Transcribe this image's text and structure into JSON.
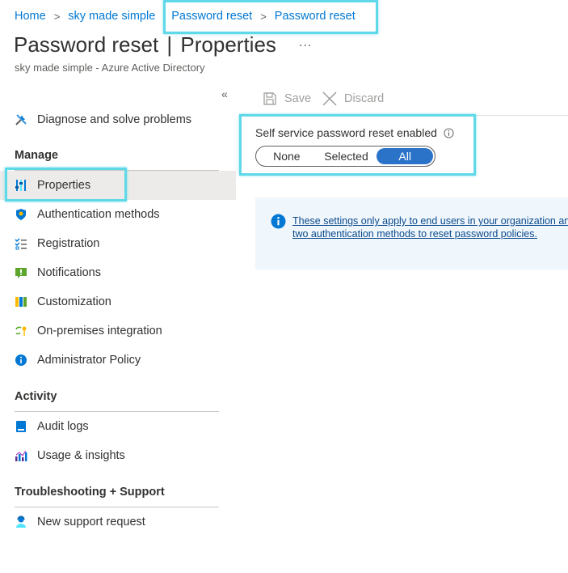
{
  "breadcrumb": {
    "items": [
      "Home",
      "sky made simple",
      "Password reset",
      "Password reset"
    ]
  },
  "header": {
    "title_main": "Password reset",
    "title_separator": "|",
    "title_section": "Properties",
    "more": "...",
    "subtitle": "sky made simple - Azure Active Directory"
  },
  "sidebar": {
    "collapse": "«",
    "top_items": [
      {
        "label": "Diagnose and solve problems",
        "icon": "wrench-screwdriver-icon"
      }
    ],
    "sections": [
      {
        "title": "Manage",
        "items": [
          {
            "label": "Properties",
            "icon": "properties-icon",
            "selected": true
          },
          {
            "label": "Authentication methods",
            "icon": "shield-icon"
          },
          {
            "label": "Registration",
            "icon": "list-checks-icon"
          },
          {
            "label": "Notifications",
            "icon": "notification-icon"
          },
          {
            "label": "Customization",
            "icon": "customization-icon"
          },
          {
            "label": "On-premises integration",
            "icon": "sync-key-icon"
          },
          {
            "label": "Administrator Policy",
            "icon": "info-icon"
          }
        ]
      },
      {
        "title": "Activity",
        "items": [
          {
            "label": "Audit logs",
            "icon": "audit-log-icon"
          },
          {
            "label": "Usage & insights",
            "icon": "chart-icon"
          }
        ]
      },
      {
        "title": "Troubleshooting + Support",
        "items": [
          {
            "label": "New support request",
            "icon": "support-person-icon"
          }
        ]
      }
    ]
  },
  "toolbar": {
    "save_label": "Save",
    "discard_label": "Discard"
  },
  "sspr": {
    "label": "Self service password reset enabled",
    "options": [
      "None",
      "Selected",
      "All"
    ],
    "selected": "All"
  },
  "info_box": {
    "text": "These settings only apply to end users in your organization and are required to use two authentication methods to reset password policies."
  },
  "colors": {
    "accent": "#0078d4",
    "highlight": "#5fd8e8",
    "toggle_selected": "#2b73c9",
    "info_bg": "#eff6fc"
  }
}
